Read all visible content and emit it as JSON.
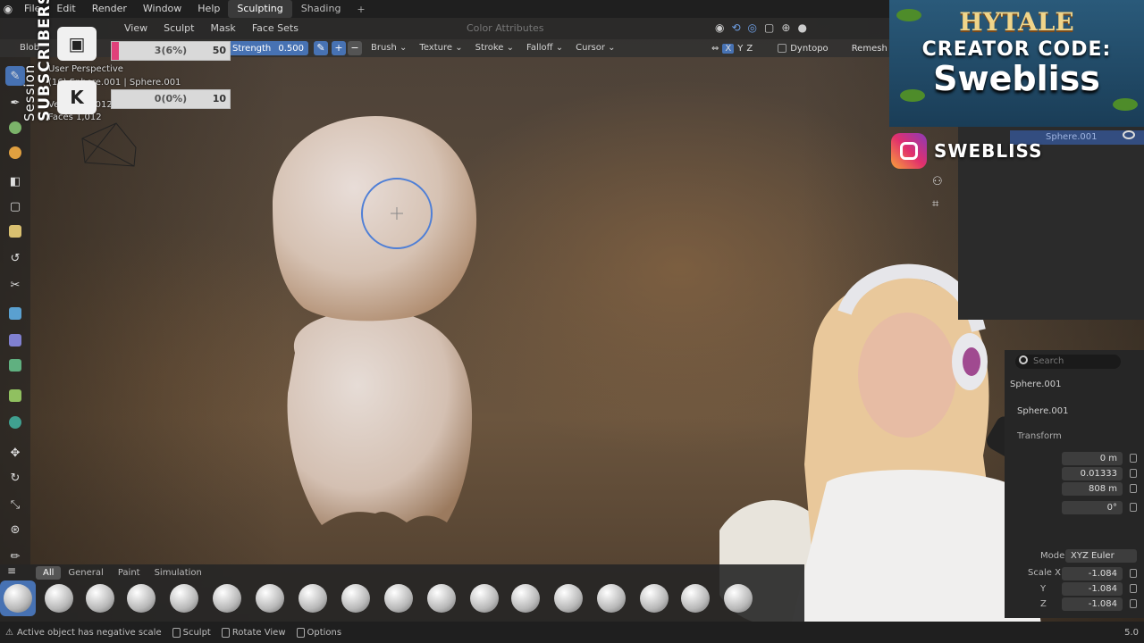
{
  "menubar": {
    "items": [
      "File",
      "Edit",
      "Render",
      "Window",
      "Help"
    ],
    "workspaces": [
      "Sculpting",
      "Shading"
    ],
    "active_workspace": "Sculpting"
  },
  "header": {
    "mode_menus": [
      "View",
      "Sculpt",
      "Mask",
      "Face Sets"
    ],
    "color_attributes": "Color Attributes",
    "axis": [
      "X",
      "Y",
      "Z"
    ],
    "dyntopo": "Dyntopo",
    "remesh": "Remesh"
  },
  "toolheader": {
    "brush_name": "Blob",
    "strength_label": "Strength",
    "strength_value": "0.500",
    "menus": [
      "Brush",
      "Texture",
      "Stroke",
      "Falloff",
      "Cursor"
    ]
  },
  "viewport": {
    "perspective": "User Perspective",
    "object_label": "(16) Sphere.001 | Sphere.001",
    "stat1": "Vertices  1,012",
    "stat2": "Faces  1,012"
  },
  "stream": {
    "sub_bar_text": "3(6%)",
    "sub_bar_goal": "50",
    "sub_bar_progress": 0.06,
    "session_bar_text": "0(0%)",
    "session_bar_goal": "10",
    "session_bar_progress": 0.0,
    "vertical_1": "SUBSCRIBERS",
    "vertical_2": "Session",
    "hytale_title": "HYTALE",
    "creator_line": "CREATOR CODE:",
    "creator_code": "Swebliss",
    "instagram": "SWEBLISS"
  },
  "outliner": {
    "selected": "Sphere.001"
  },
  "properties": {
    "search_placeholder": "Search",
    "object_name": "Sphere.001",
    "data_name": "Sphere.001",
    "transform_label": "Transform",
    "location_x": "0 m",
    "location_y": "0.01333",
    "location_z": "808 m",
    "rotation_x": "0°",
    "mode_label": "Mode",
    "mode_value": "XYZ Euler",
    "scale_x_label": "Scale X",
    "scale_x": "-1.084",
    "scale_y_label": "Y",
    "scale_y": "-1.084",
    "scale_z_label": "Z",
    "scale_z": "-1.084"
  },
  "brushbar": {
    "tabs": [
      "All",
      "General",
      "Paint",
      "Simulation"
    ],
    "active_tab": "All"
  },
  "status": {
    "warning": "Active object has negative scale",
    "sculpt": "Sculpt",
    "rotate": "Rotate View",
    "options": "Options",
    "version": "5.0"
  }
}
